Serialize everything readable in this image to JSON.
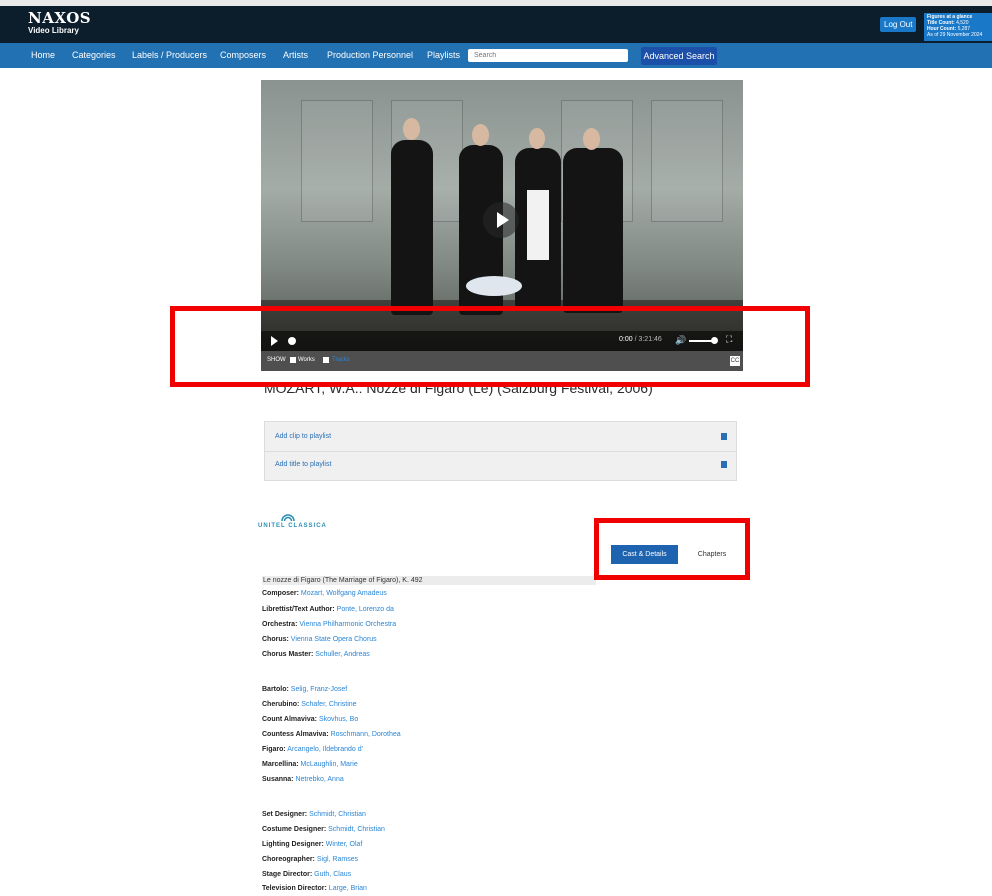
{
  "header": {
    "brand": "NAXOS",
    "brand_sub": "Video Library",
    "logout_label": "Log Out",
    "glance": {
      "heading": "Figures at a glance",
      "title_count_label": "Title Count:",
      "title_count": "4,520",
      "hour_count_label": "Hour Count:",
      "hour_count": "5,287",
      "as_of": "As of 29 November 2024"
    }
  },
  "nav": {
    "items": [
      "Home",
      "Categories",
      "Labels / Producers",
      "Composers",
      "Artists",
      "Production Personnel",
      "Playlists"
    ],
    "search_placeholder": "Search",
    "advanced_search_label": "Advanced Search"
  },
  "player": {
    "time_current": "0:00",
    "time_duration": "/ 3:21:46",
    "show_label": "SHOW",
    "works_label": "Works",
    "tracks_label": "Tracks",
    "cc_label": "CC",
    "progress_fraction": 0
  },
  "title": "MOZART, W.A.: Nozze di Figaro (Le) (Salzburg Festival, 2006)",
  "playlist": {
    "add_clip": "Add clip to playlist",
    "add_title": "Add title to playlist"
  },
  "label_logo": "UNITEL CLASSICA",
  "tabs": {
    "cast_details": "Cast & Details",
    "chapters": "Chapters"
  },
  "work_title": "Le nozze di Figaro (The Marriage of Figaro), K. 492",
  "credits_group1": [
    {
      "role": "Composer:",
      "name": "Mozart, Wolfgang Amadeus"
    },
    {
      "role": "Librettist/Text Author:",
      "name": "Ponte, Lorenzo da"
    },
    {
      "role": "Orchestra:",
      "name": "Vienna Philharmonic Orchestra"
    },
    {
      "role": "Chorus:",
      "name": "Vienna State Opera Chorus"
    },
    {
      "role": "Chorus Master:",
      "name": "Schuller, Andreas"
    }
  ],
  "credits_group2": [
    {
      "role": "Bartolo:",
      "name": "Selig, Franz-Josef"
    },
    {
      "role": "Cherubino:",
      "name": "Schafer, Christine"
    },
    {
      "role": "Count Almaviva:",
      "name": "Skovhus, Bo"
    },
    {
      "role": "Countess Almaviva:",
      "name": "Roschmann, Dorothea"
    },
    {
      "role": "Figaro:",
      "name": "Arcangelo, Ildebrando d'"
    },
    {
      "role": "Marcellina:",
      "name": "McLaughlin, Marie"
    },
    {
      "role": "Susanna:",
      "name": "Netrebko, Anna"
    }
  ],
  "credits_group3": [
    {
      "role": "Set Designer:",
      "name": "Schmidt, Christian"
    },
    {
      "role": "Costume Designer:",
      "name": "Schmidt, Christian"
    },
    {
      "role": "Lighting Designer:",
      "name": "Winter, Olaf"
    },
    {
      "role": "Choreographer:",
      "name": "Sigl, Ramses"
    },
    {
      "role": "Stage Director:",
      "name": "Guth, Claus"
    },
    {
      "role": "Television Director:",
      "name": "Large, Brian"
    }
  ],
  "colors": {
    "header_bg": "#0c1e2b",
    "nav_bg": "#2271b3",
    "accent": "#1e63b0",
    "link": "#2a86d6",
    "annotation_red": "#f10000"
  }
}
